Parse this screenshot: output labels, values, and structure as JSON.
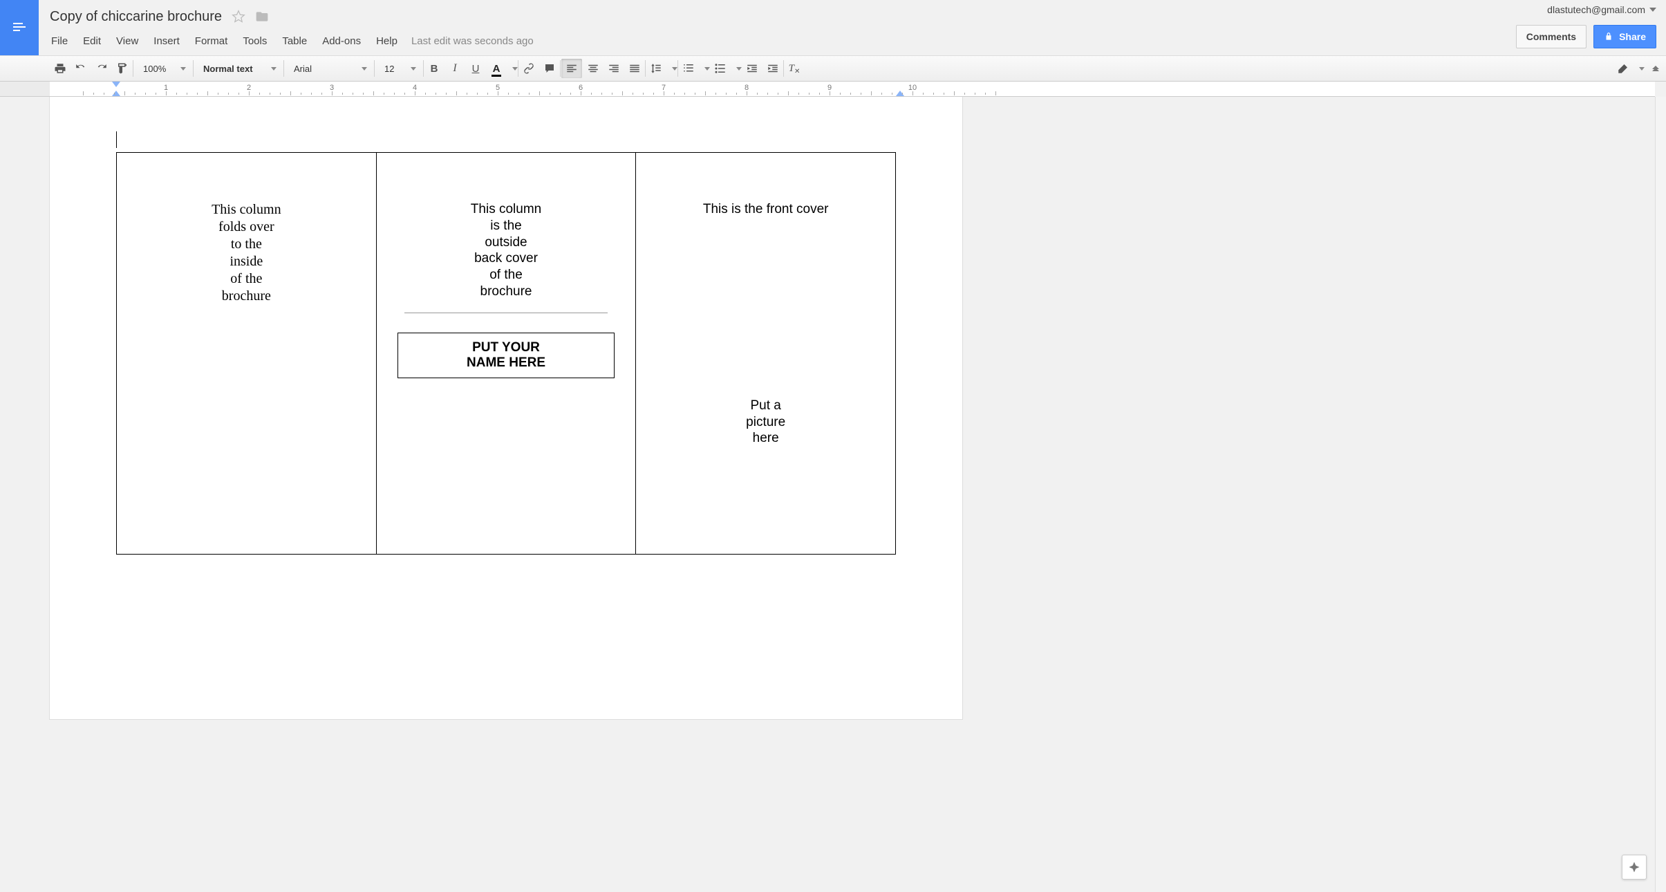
{
  "header": {
    "doc_title": "Copy of chiccarine brochure",
    "account_email": "dlastutech@gmail.com",
    "comments_label": "Comments",
    "share_label": "Share"
  },
  "menu": {
    "items": [
      "File",
      "Edit",
      "View",
      "Insert",
      "Format",
      "Tools",
      "Table",
      "Add-ons",
      "Help"
    ],
    "last_edit": "Last edit was seconds ago"
  },
  "toolbar": {
    "zoom": "100%",
    "style": "Normal text",
    "font": "Arial",
    "size": "12"
  },
  "ruler": {
    "numbers": [
      1,
      2,
      3,
      4,
      5,
      6,
      7,
      8,
      9,
      10
    ]
  },
  "doc": {
    "col1": "This column\nfolds over\nto the\ninside\nof the\nbrochure",
    "col2_text": "This column\nis the\noutside\nback cover\nof the\nbrochure",
    "col2_name_box": "PUT YOUR\nNAME HERE",
    "col3_title": "This is the front cover",
    "col3_pic": "Put a\npicture\nhere"
  }
}
